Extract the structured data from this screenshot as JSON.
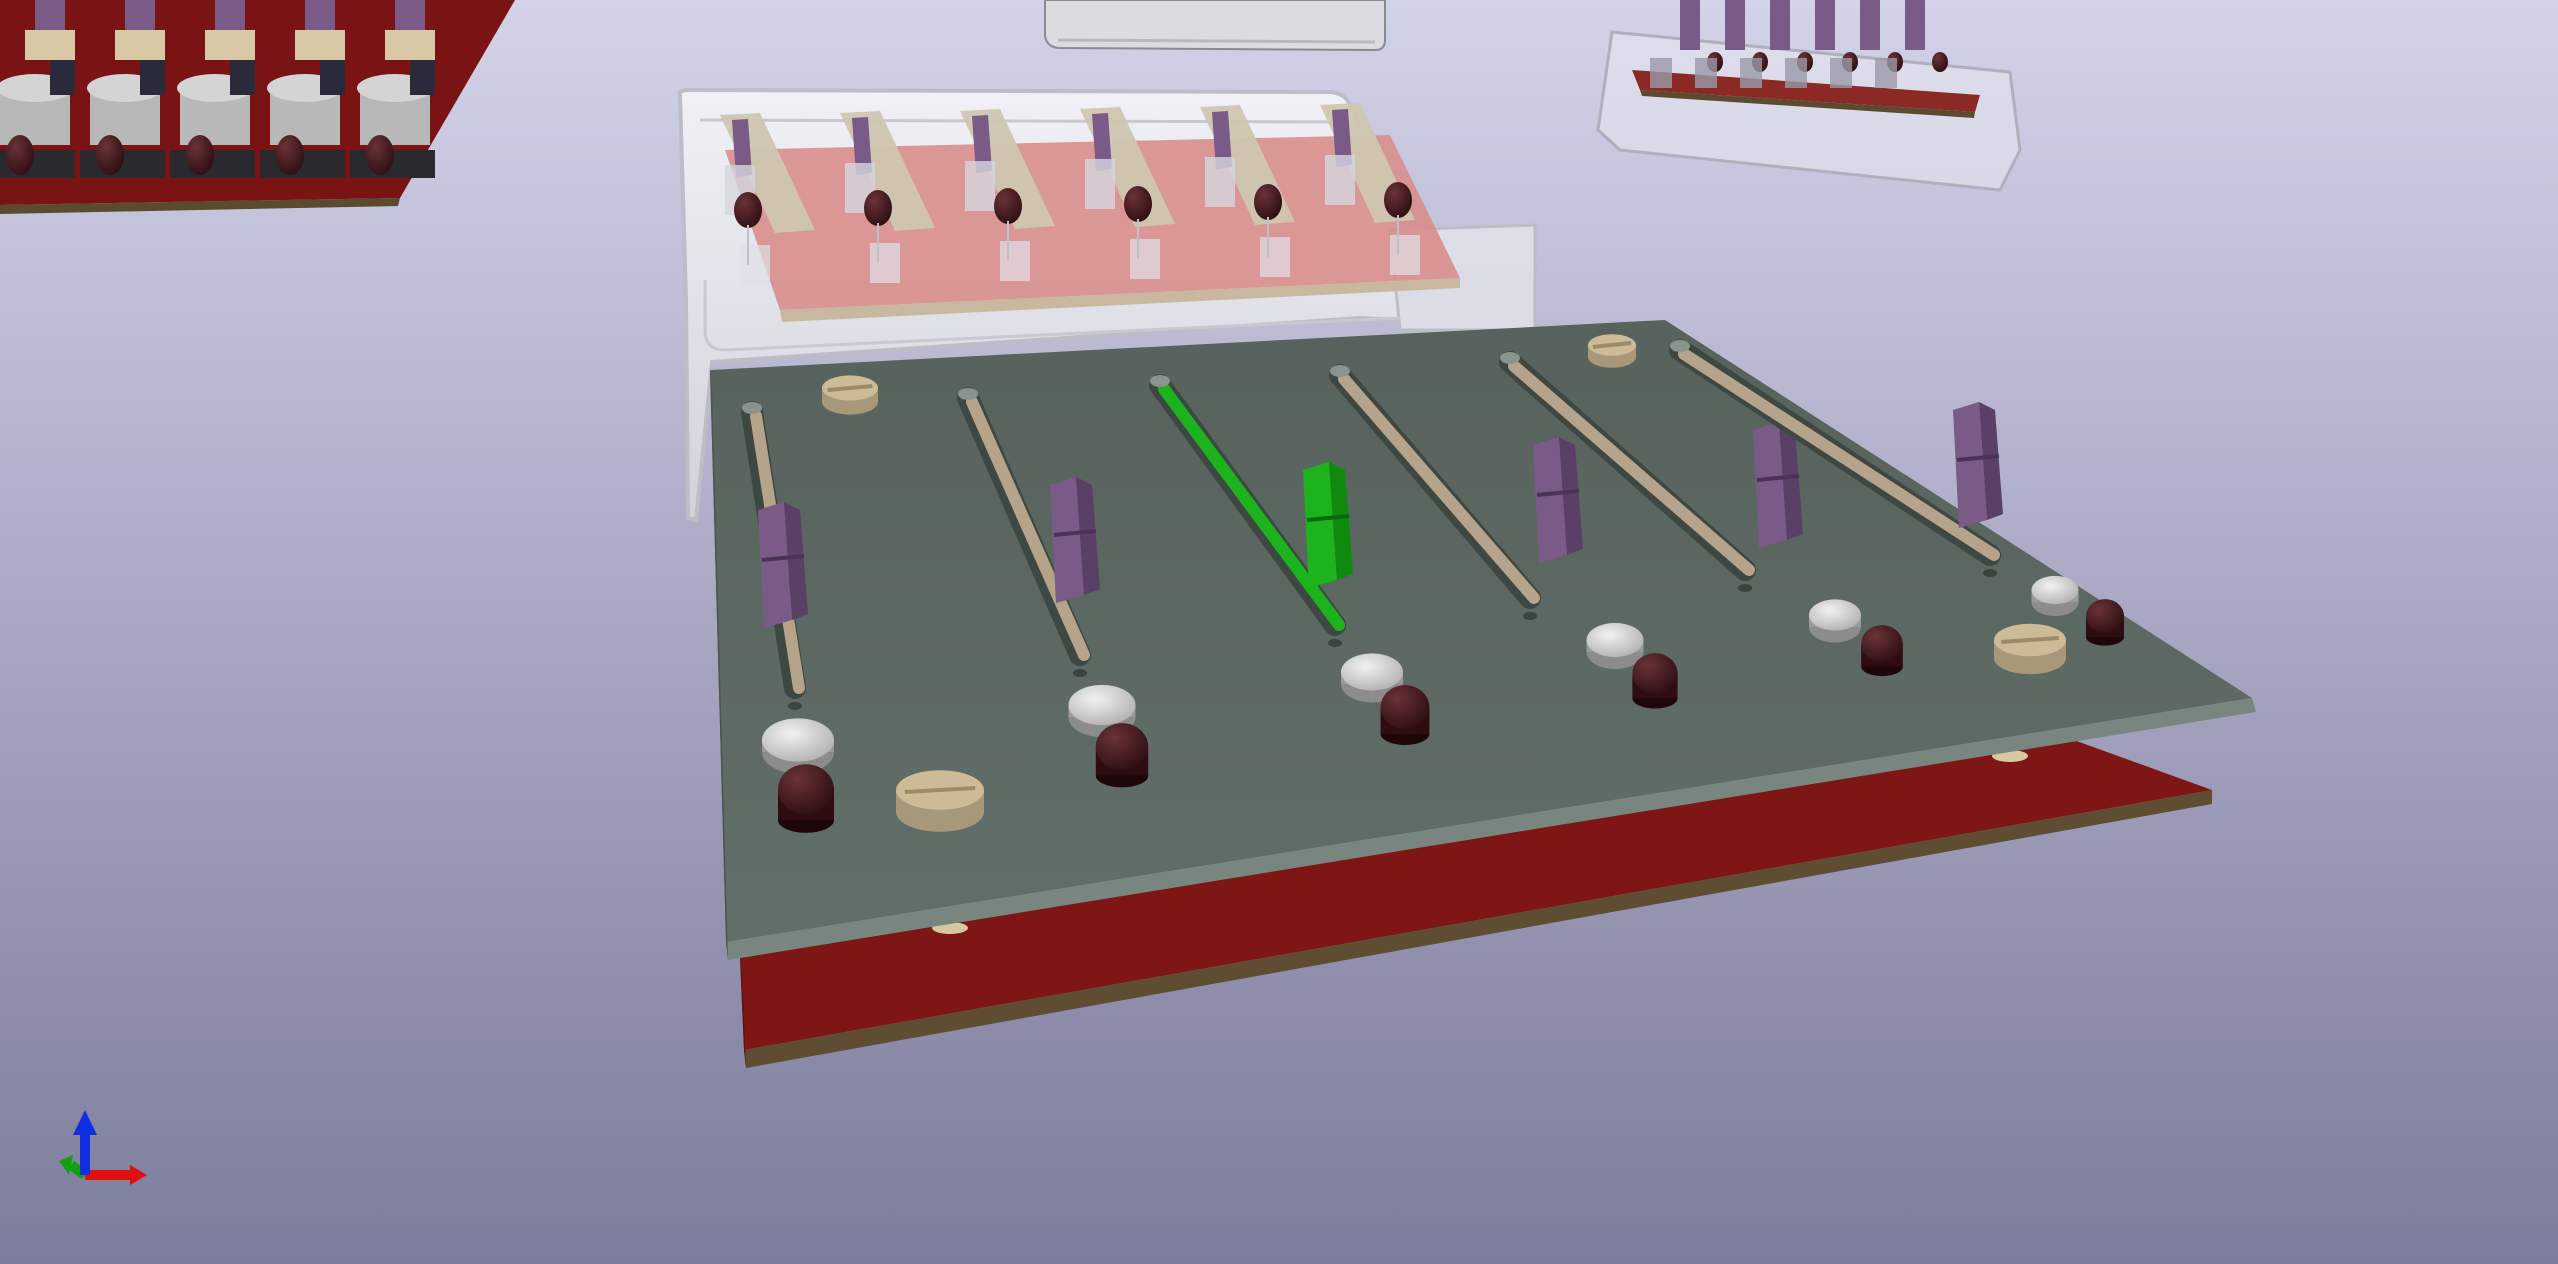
{
  "viewer": {
    "mode": "3D Viewer",
    "background_top": "#cfcfe6",
    "background_bottom": "#7a7a9a"
  },
  "colors": {
    "front_panel": "#5c6862",
    "front_panel_edge": "#6f7c76",
    "pcb_red": "#7a1414",
    "pcb_edge": "#5a4a30",
    "enclosure": "#e8e8ec",
    "slider_track": "#b5a38a",
    "slider_knob": "#7a5a86",
    "selected_slider": "#1db31d",
    "led": "#3a1216",
    "button_cap": "#d8d8d8",
    "screw": "#cdbb98",
    "axis_x": "#e01010",
    "axis_y": "#10a010",
    "axis_z": "#1030e0"
  },
  "panel": {
    "channels": 6,
    "selected_channel_index": 2
  },
  "axes": {
    "x": "x-axis",
    "y": "y-axis",
    "z": "z-axis"
  }
}
